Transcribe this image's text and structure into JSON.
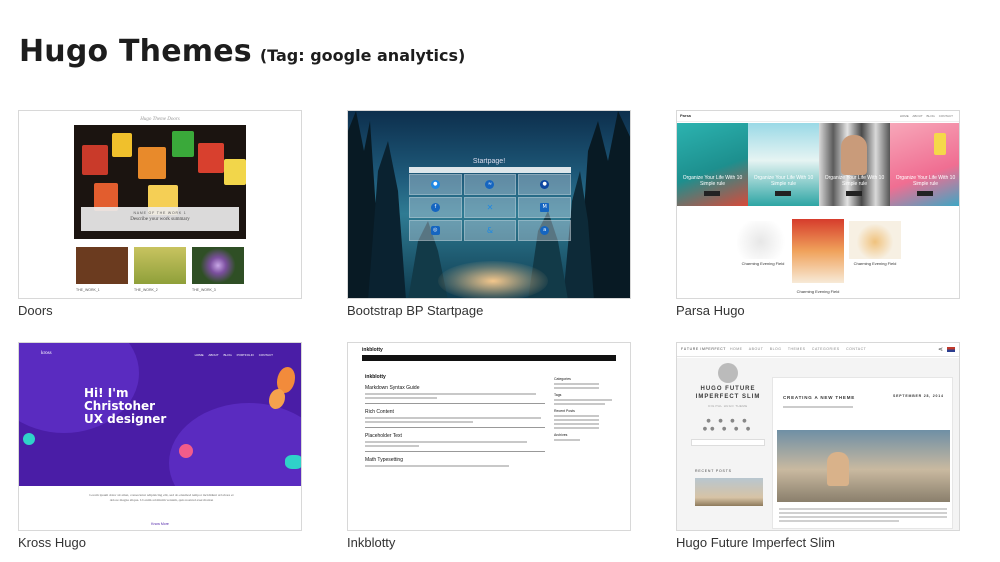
{
  "page": {
    "title": "Hugo Themes",
    "tag_label": "(Tag: google analytics)"
  },
  "themes": [
    {
      "name": "Doors",
      "thumb": {
        "site_title": "Hugo Theme Doors",
        "caption_small": "NAME OF THE WORK 1",
        "caption_main": "Describe your work summary",
        "items": [
          "THE_WORK_1",
          "THE_WORK_2",
          "THE_WORK_3"
        ]
      }
    },
    {
      "name": "Bootstrap BP Startpage",
      "thumb": {
        "heading": "Startpage!"
      }
    },
    {
      "name": "Parsa Hugo",
      "thumb": {
        "brand": "Parsa",
        "menu": "HOME ABOUT BLOG CONTACT",
        "hero_text": "Organize Your Life With 10 Simple rule",
        "card_caption": "Charming Evening Field"
      }
    },
    {
      "name": "Kross Hugo",
      "thumb": {
        "brand": "kross",
        "menu": "HOME ABOUT BLOG PORTFOLIO CONTACT",
        "hero": [
          "Hi! I'm",
          "Christoher",
          "UX designer"
        ],
        "link": "Know More"
      }
    },
    {
      "name": "Inkblotty",
      "thumb": {
        "site": "inkblotty",
        "posts": [
          "Markdown Syntax Guide",
          "Rich Content",
          "Placeholder Text",
          "Math Typesetting"
        ]
      }
    },
    {
      "name": "Hugo Future Imperfect Slim",
      "thumb": {
        "brand": "FUTURE IMPERFECT",
        "menu": "HOME ABOUT BLOG THEMES CATEGORIES CONTACT",
        "site_name": "HUGO FUTURE IMPERFECT SLIM",
        "post_title": "CREATING A NEW THEME",
        "post_date": "SEPTEMBER 28, 2014",
        "recent": "RECENT POSTS"
      }
    }
  ],
  "colors": {
    "kross_purple": "#4a1da6",
    "text": "#1d1d1d"
  }
}
